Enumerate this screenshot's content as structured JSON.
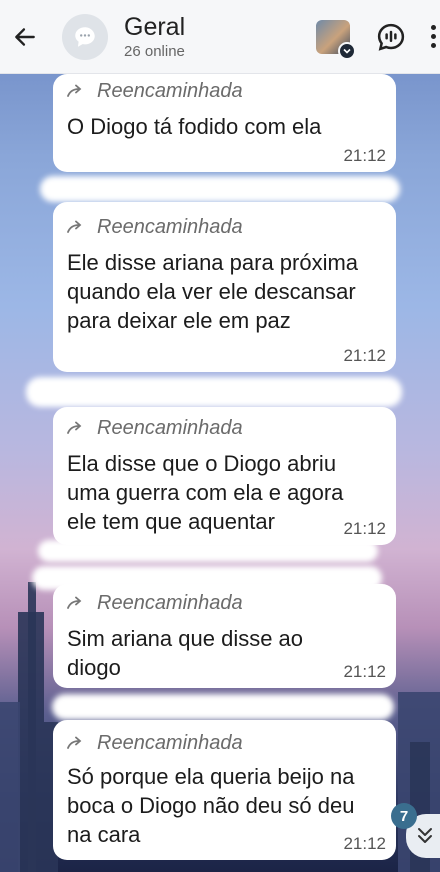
{
  "header": {
    "title": "Geral",
    "subtitle": "26 online"
  },
  "messages": [
    {
      "forward_label": "Reencaminhada",
      "text": "O Diogo tá fodido com ela",
      "time": "21:12"
    },
    {
      "forward_label": "Reencaminhada",
      "text": "Ele disse ariana para próxima quando ela ver ele descansar para deixar ele em paz",
      "time": "21:12"
    },
    {
      "forward_label": "Reencaminhada",
      "text": "Ela disse que o Diogo abriu uma guerra com ela e agora ele tem que aquentar",
      "time": "21:12"
    },
    {
      "forward_label": "Reencaminhada",
      "text": "Sim ariana que disse ao diogo",
      "time": "21:12"
    },
    {
      "forward_label": "Reencaminhada",
      "text": "Só porque ela queria beijo na boca o Diogo não deu só deu na cara",
      "time": "21:12"
    }
  ],
  "unread_count": "7",
  "colors": {
    "header_bg": "#f6f7f9",
    "bubble_bg": "#ffffff",
    "badge": "#3a6e8f"
  },
  "icons": {
    "back": "arrow-left-icon",
    "group": "chat-bubble-icon",
    "call": "voice-chat-icon",
    "menu": "more-vertical-icon",
    "forward": "forward-arrow-icon",
    "scroll": "double-chevron-down-icon"
  }
}
